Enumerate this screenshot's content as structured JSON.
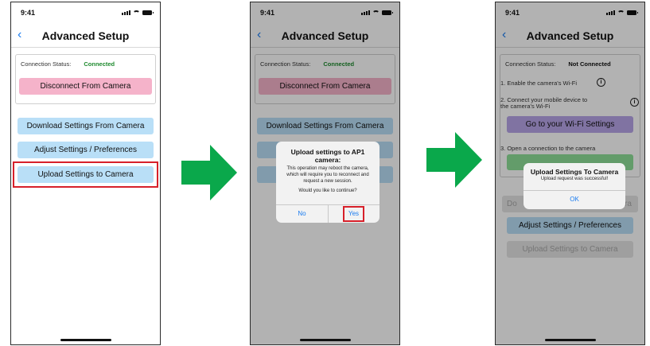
{
  "status_time": "9:41",
  "nav": {
    "back_glyph": "‹",
    "title": "Advanced Setup"
  },
  "connection": {
    "label": "Connection Status:",
    "connected": "Connected",
    "not_connected": "Not Connected"
  },
  "buttons": {
    "disconnect": "Disconnect From Camera",
    "download": "Download Settings From Camera",
    "adjust": "Adjust Settings / Preferences",
    "upload": "Upload Settings to Camera",
    "wifi_settings": "Go to your Wi-Fi Settings"
  },
  "steps": {
    "step1": "1. Enable the camera's Wi-Fi",
    "step2": "2. Connect your mobile device to the camera's Wi-Fi",
    "step3": "3. Open a connection to the camera",
    "info_glyph": "i"
  },
  "upload_dialog": {
    "title": "Upload settings to AP1 camera:",
    "message": "This operation may reboot the camera, which will require you to reconnect and request a new session.",
    "question": "Would you like to continue?",
    "no": "No",
    "yes": "Yes"
  },
  "success_dialog": {
    "title": "Upload Settings To Camera",
    "message": "Upload request was successful!",
    "ok": "OK"
  },
  "partial_labels": {
    "download_left": "Do",
    "download_right": "ra"
  },
  "colors": {
    "arrow": "#0aa84b",
    "highlight": "#d7202a",
    "link": "#1a7cf0",
    "connected": "#1e8a2e"
  }
}
